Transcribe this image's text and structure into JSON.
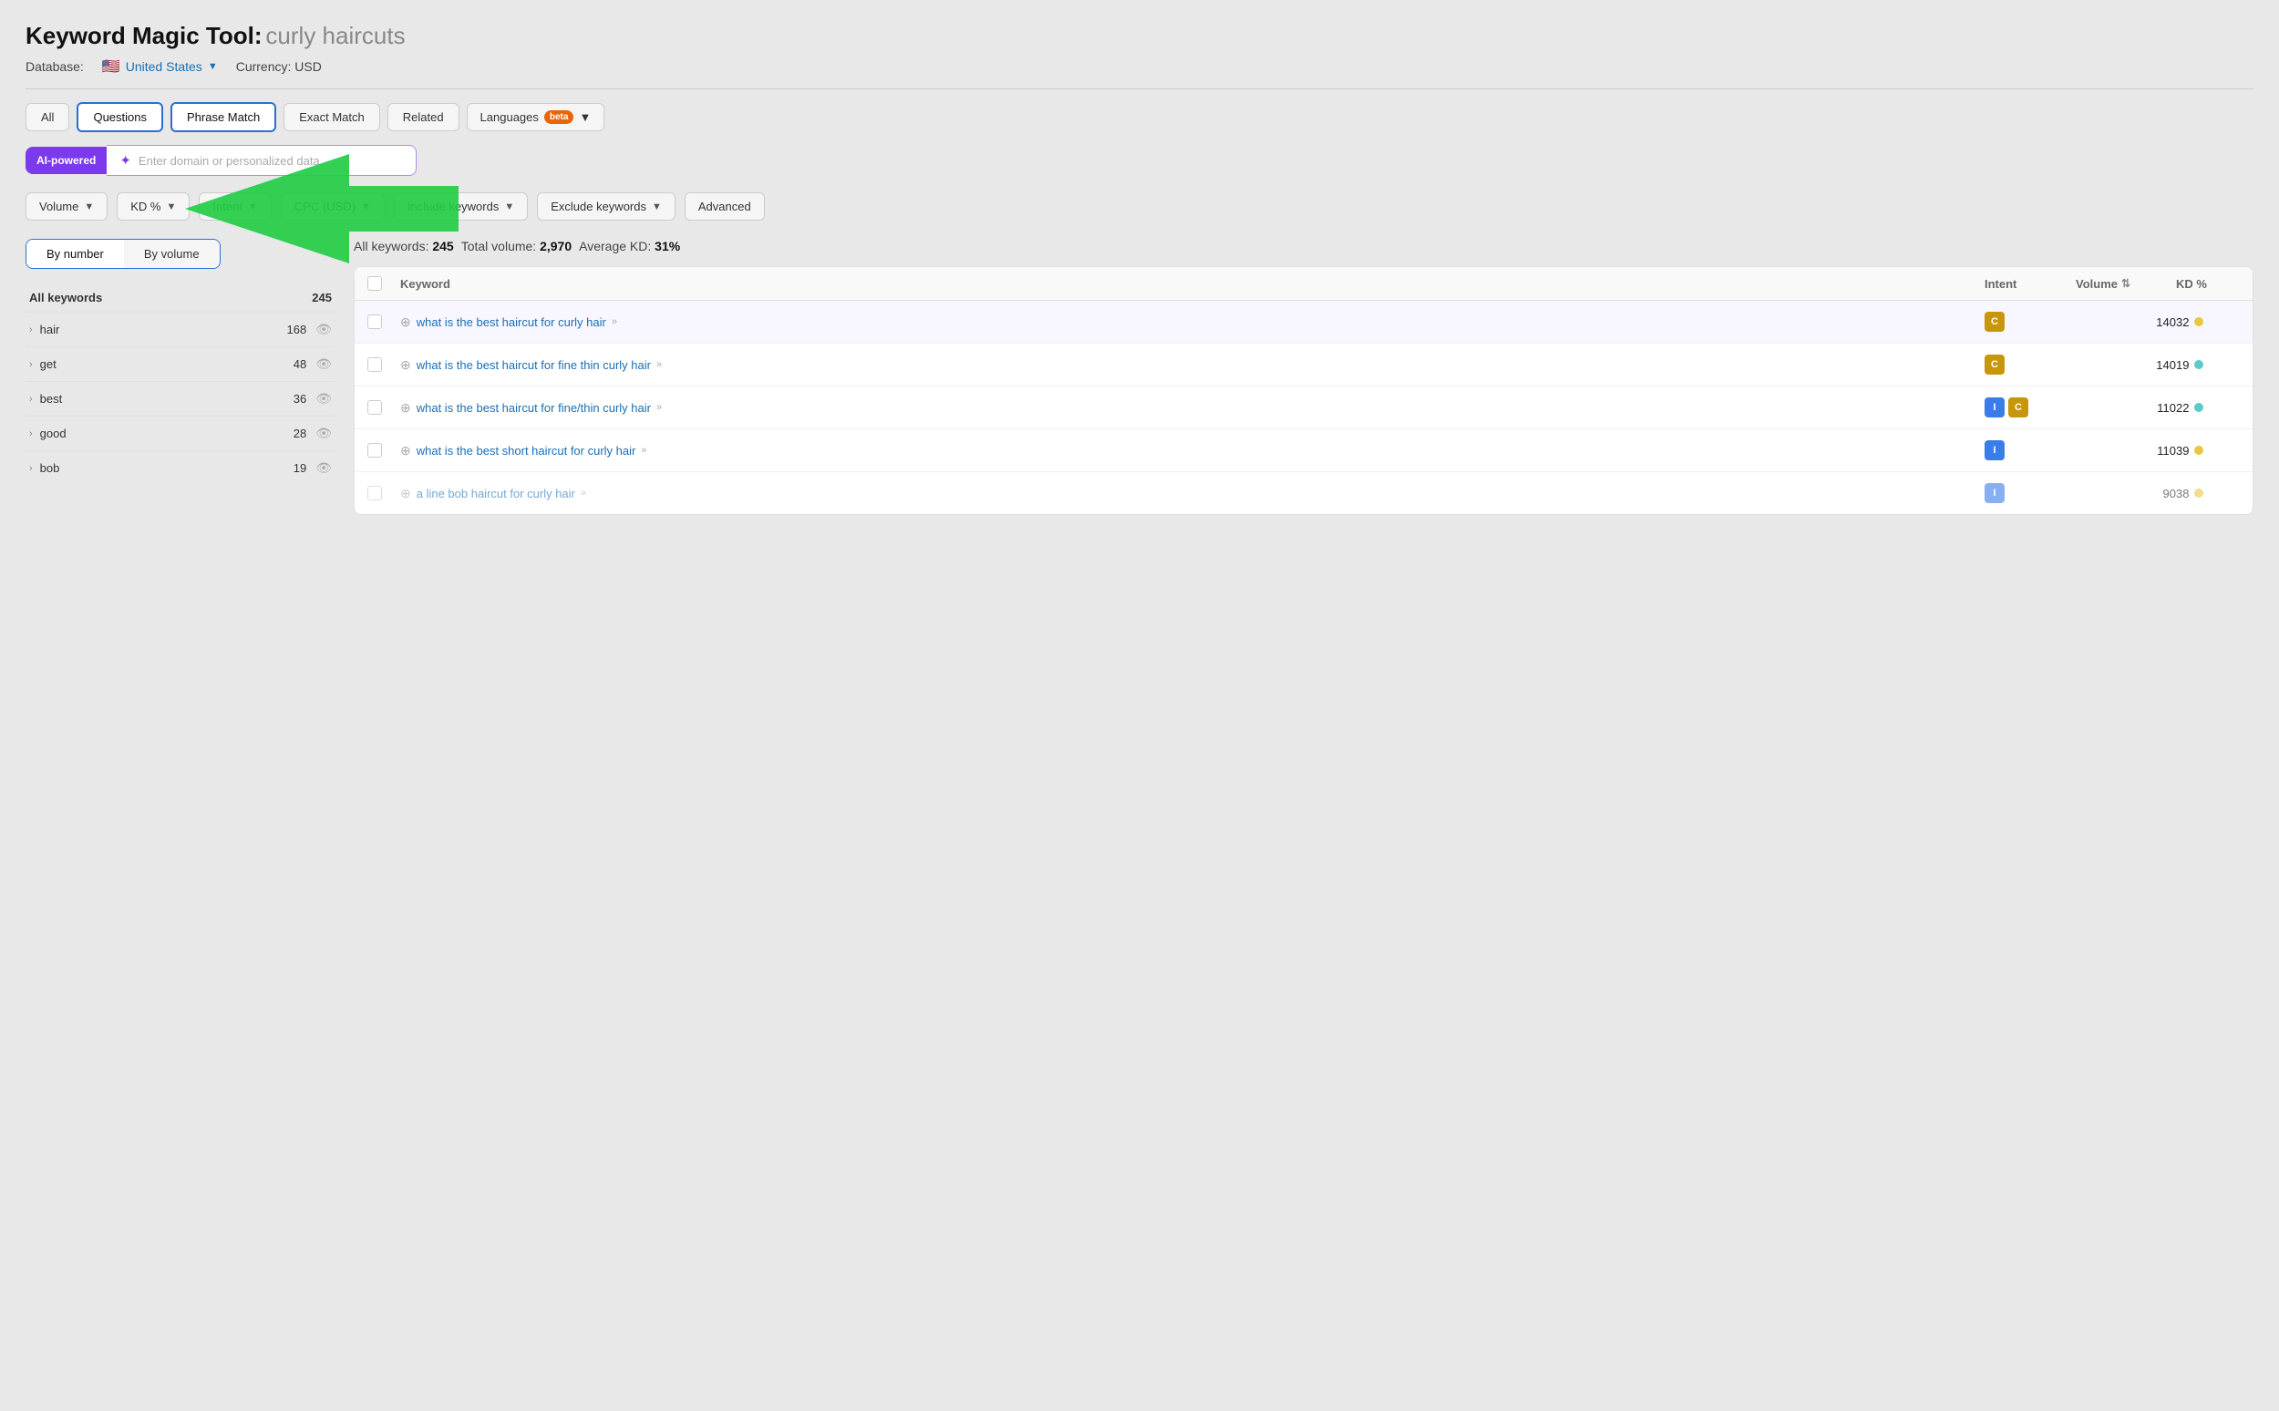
{
  "title": {
    "prefix": "Keyword Magic Tool:",
    "query": " curly haircuts"
  },
  "database": {
    "label": "Database:",
    "flag": "🇺🇸",
    "country": "United States",
    "currency_label": "Currency: USD"
  },
  "tabs": [
    {
      "label": "All",
      "active": false
    },
    {
      "label": "Questions",
      "active": true
    },
    {
      "label": "Phrase Match",
      "active": false
    },
    {
      "label": "Exact Match",
      "active": false
    },
    {
      "label": "Related",
      "active": false
    }
  ],
  "languages_btn": "Languages",
  "beta_label": "beta",
  "ai": {
    "label": "AI-powered",
    "placeholder": "Enter domain or personalized data"
  },
  "filters": [
    {
      "label": "Volume",
      "has_caret": true
    },
    {
      "label": "KD %",
      "has_caret": true
    },
    {
      "label": "Intent",
      "has_caret": true
    },
    {
      "label": "CPC (USD)",
      "has_caret": true
    },
    {
      "label": "Include keywords",
      "has_caret": true
    },
    {
      "label": "Exclude keywords",
      "has_caret": true
    },
    {
      "label": "Advanced",
      "has_caret": false
    }
  ],
  "toggle": {
    "options": [
      "By number",
      "By volume"
    ],
    "active": 0
  },
  "sidebar": {
    "header": {
      "label": "All keywords",
      "count": "245"
    },
    "rows": [
      {
        "keyword": "hair",
        "count": "168",
        "show_eye": true
      },
      {
        "keyword": "get",
        "count": "48",
        "show_eye": true
      },
      {
        "keyword": "best",
        "count": "36",
        "show_eye": true
      },
      {
        "keyword": "good",
        "count": "28",
        "show_eye": true
      },
      {
        "keyword": "bob",
        "count": "19",
        "show_eye": true
      }
    ]
  },
  "stats": {
    "all_keywords_label": "All keywords:",
    "all_keywords_value": "245",
    "total_volume_label": "Total volume:",
    "total_volume_value": "2,970",
    "avg_kd_label": "Average KD:",
    "avg_kd_value": "31%"
  },
  "table": {
    "columns": [
      "",
      "Keyword",
      "Intent",
      "Volume",
      "KD %"
    ],
    "rows": [
      {
        "keyword": "what is the best haircut for curly hair",
        "intent": [
          "C"
        ],
        "volume": "140",
        "kd": "32",
        "kd_color": "yellow",
        "highlighted": true
      },
      {
        "keyword": "what is the best haircut for fine thin curly hair",
        "intent": [
          "C"
        ],
        "volume": "140",
        "kd": "19",
        "kd_color": "teal",
        "highlighted": false
      },
      {
        "keyword": "what is the best haircut for fine/thin curly hair",
        "intent": [
          "I",
          "C"
        ],
        "volume": "110",
        "kd": "22",
        "kd_color": "teal",
        "highlighted": false
      },
      {
        "keyword": "what is the best short haircut for curly hair",
        "intent": [
          "I"
        ],
        "volume": "110",
        "kd": "39",
        "kd_color": "yellow",
        "highlighted": false
      },
      {
        "keyword": "a line bob haircut for curly hair",
        "intent": [
          "I"
        ],
        "volume": "90",
        "kd": "38",
        "kd_color": "yellow",
        "highlighted": false,
        "partial": true
      }
    ]
  }
}
